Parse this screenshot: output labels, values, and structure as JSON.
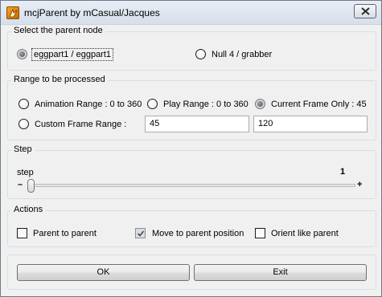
{
  "window": {
    "title": "mcjParent by mCasual/Jacques",
    "close_icon": "close-x-icon",
    "app_icon": "app-icon"
  },
  "parent_node": {
    "legend": "Select the parent node",
    "options": [
      {
        "label": "eggpart1 / eggpart1",
        "checked": true
      },
      {
        "label": "Null 4 / grabber",
        "checked": false
      }
    ]
  },
  "range": {
    "legend": "Range to be processed",
    "options": [
      {
        "label": "Animation Range : 0 to 360",
        "checked": false
      },
      {
        "label": "Play Range : 0 to 360",
        "checked": false
      },
      {
        "label": "Current Frame Only : 45",
        "checked": true
      },
      {
        "label": "Custom Frame Range :",
        "checked": false
      }
    ],
    "start_value": "45",
    "end_value": "120"
  },
  "step": {
    "legend": "Step",
    "label": "step",
    "value": "1",
    "minus": "–",
    "plus": "+"
  },
  "actions": {
    "legend": "Actions",
    "options": [
      {
        "label": "Parent to parent",
        "checked": false
      },
      {
        "label": "Move to parent position",
        "checked": true
      },
      {
        "label": "Orient like parent",
        "checked": false
      }
    ]
  },
  "buttons": {
    "ok": "OK",
    "exit": "Exit"
  }
}
